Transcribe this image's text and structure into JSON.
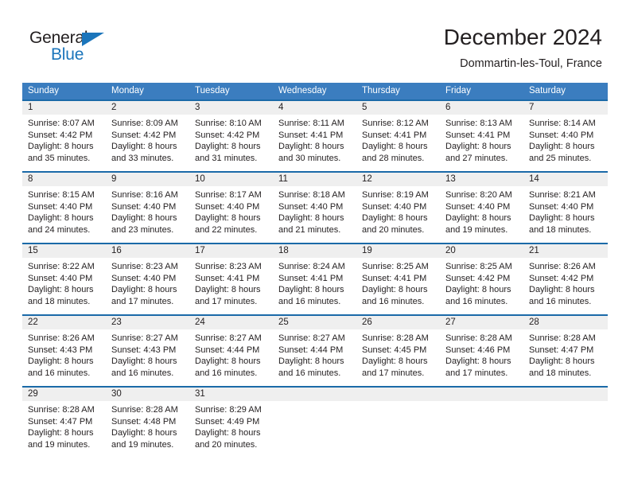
{
  "brand": {
    "name_dark": "General",
    "name_blue": "Blue",
    "accent_color": "#1b75bb"
  },
  "header": {
    "title": "December 2024",
    "subtitle": "Dommartin-les-Toul, France"
  },
  "colors": {
    "header_band": "#3b7dbf",
    "row_divider": "#1b6aa8",
    "daynum_strip": "#efefef",
    "text": "#231f20"
  },
  "weekday_headers": [
    "Sunday",
    "Monday",
    "Tuesday",
    "Wednesday",
    "Thursday",
    "Friday",
    "Saturday"
  ],
  "weeks": [
    [
      {
        "day": "1",
        "sunrise": "Sunrise: 8:07 AM",
        "sunset": "Sunset: 4:42 PM",
        "daylight_1": "Daylight: 8 hours",
        "daylight_2": "and 35 minutes."
      },
      {
        "day": "2",
        "sunrise": "Sunrise: 8:09 AM",
        "sunset": "Sunset: 4:42 PM",
        "daylight_1": "Daylight: 8 hours",
        "daylight_2": "and 33 minutes."
      },
      {
        "day": "3",
        "sunrise": "Sunrise: 8:10 AM",
        "sunset": "Sunset: 4:42 PM",
        "daylight_1": "Daylight: 8 hours",
        "daylight_2": "and 31 minutes."
      },
      {
        "day": "4",
        "sunrise": "Sunrise: 8:11 AM",
        "sunset": "Sunset: 4:41 PM",
        "daylight_1": "Daylight: 8 hours",
        "daylight_2": "and 30 minutes."
      },
      {
        "day": "5",
        "sunrise": "Sunrise: 8:12 AM",
        "sunset": "Sunset: 4:41 PM",
        "daylight_1": "Daylight: 8 hours",
        "daylight_2": "and 28 minutes."
      },
      {
        "day": "6",
        "sunrise": "Sunrise: 8:13 AM",
        "sunset": "Sunset: 4:41 PM",
        "daylight_1": "Daylight: 8 hours",
        "daylight_2": "and 27 minutes."
      },
      {
        "day": "7",
        "sunrise": "Sunrise: 8:14 AM",
        "sunset": "Sunset: 4:40 PM",
        "daylight_1": "Daylight: 8 hours",
        "daylight_2": "and 25 minutes."
      }
    ],
    [
      {
        "day": "8",
        "sunrise": "Sunrise: 8:15 AM",
        "sunset": "Sunset: 4:40 PM",
        "daylight_1": "Daylight: 8 hours",
        "daylight_2": "and 24 minutes."
      },
      {
        "day": "9",
        "sunrise": "Sunrise: 8:16 AM",
        "sunset": "Sunset: 4:40 PM",
        "daylight_1": "Daylight: 8 hours",
        "daylight_2": "and 23 minutes."
      },
      {
        "day": "10",
        "sunrise": "Sunrise: 8:17 AM",
        "sunset": "Sunset: 4:40 PM",
        "daylight_1": "Daylight: 8 hours",
        "daylight_2": "and 22 minutes."
      },
      {
        "day": "11",
        "sunrise": "Sunrise: 8:18 AM",
        "sunset": "Sunset: 4:40 PM",
        "daylight_1": "Daylight: 8 hours",
        "daylight_2": "and 21 minutes."
      },
      {
        "day": "12",
        "sunrise": "Sunrise: 8:19 AM",
        "sunset": "Sunset: 4:40 PM",
        "daylight_1": "Daylight: 8 hours",
        "daylight_2": "and 20 minutes."
      },
      {
        "day": "13",
        "sunrise": "Sunrise: 8:20 AM",
        "sunset": "Sunset: 4:40 PM",
        "daylight_1": "Daylight: 8 hours",
        "daylight_2": "and 19 minutes."
      },
      {
        "day": "14",
        "sunrise": "Sunrise: 8:21 AM",
        "sunset": "Sunset: 4:40 PM",
        "daylight_1": "Daylight: 8 hours",
        "daylight_2": "and 18 minutes."
      }
    ],
    [
      {
        "day": "15",
        "sunrise": "Sunrise: 8:22 AM",
        "sunset": "Sunset: 4:40 PM",
        "daylight_1": "Daylight: 8 hours",
        "daylight_2": "and 18 minutes."
      },
      {
        "day": "16",
        "sunrise": "Sunrise: 8:23 AM",
        "sunset": "Sunset: 4:40 PM",
        "daylight_1": "Daylight: 8 hours",
        "daylight_2": "and 17 minutes."
      },
      {
        "day": "17",
        "sunrise": "Sunrise: 8:23 AM",
        "sunset": "Sunset: 4:41 PM",
        "daylight_1": "Daylight: 8 hours",
        "daylight_2": "and 17 minutes."
      },
      {
        "day": "18",
        "sunrise": "Sunrise: 8:24 AM",
        "sunset": "Sunset: 4:41 PM",
        "daylight_1": "Daylight: 8 hours",
        "daylight_2": "and 16 minutes."
      },
      {
        "day": "19",
        "sunrise": "Sunrise: 8:25 AM",
        "sunset": "Sunset: 4:41 PM",
        "daylight_1": "Daylight: 8 hours",
        "daylight_2": "and 16 minutes."
      },
      {
        "day": "20",
        "sunrise": "Sunrise: 8:25 AM",
        "sunset": "Sunset: 4:42 PM",
        "daylight_1": "Daylight: 8 hours",
        "daylight_2": "and 16 minutes."
      },
      {
        "day": "21",
        "sunrise": "Sunrise: 8:26 AM",
        "sunset": "Sunset: 4:42 PM",
        "daylight_1": "Daylight: 8 hours",
        "daylight_2": "and 16 minutes."
      }
    ],
    [
      {
        "day": "22",
        "sunrise": "Sunrise: 8:26 AM",
        "sunset": "Sunset: 4:43 PM",
        "daylight_1": "Daylight: 8 hours",
        "daylight_2": "and 16 minutes."
      },
      {
        "day": "23",
        "sunrise": "Sunrise: 8:27 AM",
        "sunset": "Sunset: 4:43 PM",
        "daylight_1": "Daylight: 8 hours",
        "daylight_2": "and 16 minutes."
      },
      {
        "day": "24",
        "sunrise": "Sunrise: 8:27 AM",
        "sunset": "Sunset: 4:44 PM",
        "daylight_1": "Daylight: 8 hours",
        "daylight_2": "and 16 minutes."
      },
      {
        "day": "25",
        "sunrise": "Sunrise: 8:27 AM",
        "sunset": "Sunset: 4:44 PM",
        "daylight_1": "Daylight: 8 hours",
        "daylight_2": "and 16 minutes."
      },
      {
        "day": "26",
        "sunrise": "Sunrise: 8:28 AM",
        "sunset": "Sunset: 4:45 PM",
        "daylight_1": "Daylight: 8 hours",
        "daylight_2": "and 17 minutes."
      },
      {
        "day": "27",
        "sunrise": "Sunrise: 8:28 AM",
        "sunset": "Sunset: 4:46 PM",
        "daylight_1": "Daylight: 8 hours",
        "daylight_2": "and 17 minutes."
      },
      {
        "day": "28",
        "sunrise": "Sunrise: 8:28 AM",
        "sunset": "Sunset: 4:47 PM",
        "daylight_1": "Daylight: 8 hours",
        "daylight_2": "and 18 minutes."
      }
    ],
    [
      {
        "day": "29",
        "sunrise": "Sunrise: 8:28 AM",
        "sunset": "Sunset: 4:47 PM",
        "daylight_1": "Daylight: 8 hours",
        "daylight_2": "and 19 minutes."
      },
      {
        "day": "30",
        "sunrise": "Sunrise: 8:28 AM",
        "sunset": "Sunset: 4:48 PM",
        "daylight_1": "Daylight: 8 hours",
        "daylight_2": "and 19 minutes."
      },
      {
        "day": "31",
        "sunrise": "Sunrise: 8:29 AM",
        "sunset": "Sunset: 4:49 PM",
        "daylight_1": "Daylight: 8 hours",
        "daylight_2": "and 20 minutes."
      },
      {
        "day": "",
        "sunrise": "",
        "sunset": "",
        "daylight_1": "",
        "daylight_2": ""
      },
      {
        "day": "",
        "sunrise": "",
        "sunset": "",
        "daylight_1": "",
        "daylight_2": ""
      },
      {
        "day": "",
        "sunrise": "",
        "sunset": "",
        "daylight_1": "",
        "daylight_2": ""
      },
      {
        "day": "",
        "sunrise": "",
        "sunset": "",
        "daylight_1": "",
        "daylight_2": ""
      }
    ]
  ]
}
